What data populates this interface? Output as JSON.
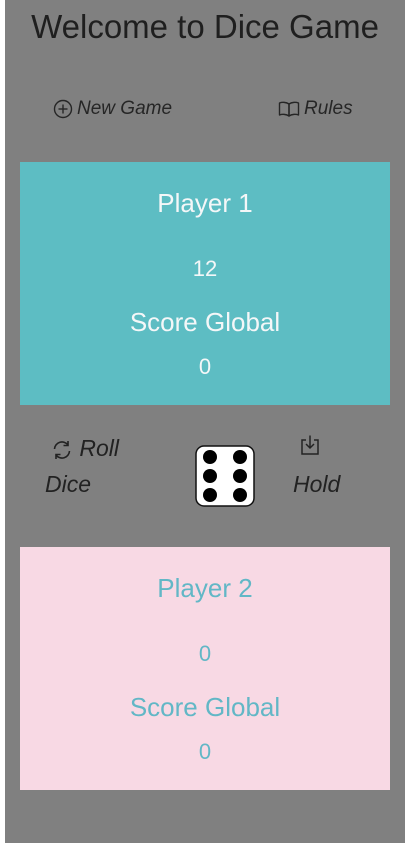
{
  "header": {
    "title": "Welcome to Dice Game"
  },
  "nav": {
    "new_game_label": "New Game",
    "new_game_icon": "plus-circle-icon",
    "rules_label": "Rules",
    "rules_icon": "book-icon"
  },
  "player1": {
    "name": "Player 1",
    "round_score": "12",
    "global_label": "Score Global",
    "global_score": "0",
    "panel_color": "#5dbdc3"
  },
  "player2": {
    "name": "Player 2",
    "round_score": "0",
    "global_label": "Score Global",
    "global_score": "0",
    "panel_color": "#f8d9e4"
  },
  "controls": {
    "roll_label_line1": "Roll",
    "roll_label_line2": "Dice",
    "roll_icon": "refresh-icon",
    "hold_label": "Hold",
    "hold_icon": "download-icon",
    "dice_value": 6
  }
}
